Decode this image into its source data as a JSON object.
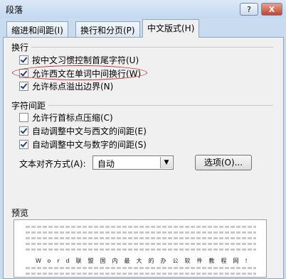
{
  "window": {
    "title": "段落",
    "help_label": "?",
    "close_label": "X"
  },
  "tabs": [
    {
      "label": "缩进和间距(I)"
    },
    {
      "label": "换行和分页(P)"
    },
    {
      "label": "中文版式(H)"
    }
  ],
  "line_break": {
    "heading": "换行",
    "options": [
      {
        "label": "按中文习惯控制首尾字符(U)",
        "checked": true
      },
      {
        "label": "允许西文在单词中间换行(W)",
        "checked": true
      },
      {
        "label": "允许标点溢出边界(N)",
        "checked": true
      }
    ]
  },
  "char_spacing": {
    "heading": "字符间距",
    "options": [
      {
        "label": "允许行首标点压缩(C)",
        "checked": false
      },
      {
        "label": "自动调整中文与西文的间距(E)",
        "checked": true
      },
      {
        "label": "自动调整中文与数字的间距(S)",
        "checked": true
      }
    ]
  },
  "text_alignment": {
    "label": "文本对齐方式(A):",
    "selected": "自动",
    "options_button": "选项(O)..."
  },
  "preview": {
    "heading": "预览",
    "sample_text": "Word联盟国内最大的办公软件教程网!"
  },
  "colors": {
    "highlight_ellipse": "#c0302a",
    "checkmark": "#1f3f8f"
  }
}
